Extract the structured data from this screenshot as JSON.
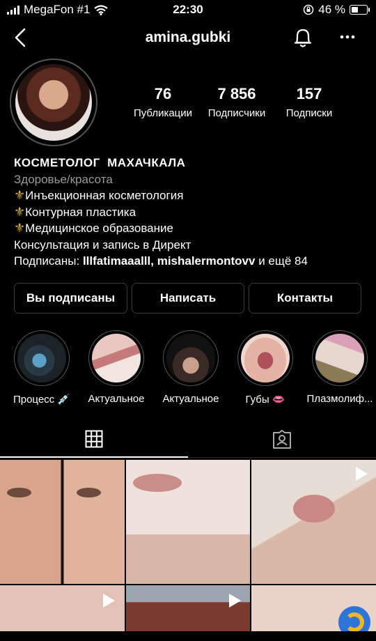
{
  "status_bar": {
    "carrier": "MegaFon #1",
    "time": "22:30",
    "battery": "46 %"
  },
  "nav": {
    "username": "amina.gubki",
    "icons": [
      "back-arrow-icon",
      "bell-icon",
      "more-icon"
    ]
  },
  "stats": [
    {
      "count": "76",
      "label": "Публикации"
    },
    {
      "count": "7 856",
      "label": "Подписчики"
    },
    {
      "count": "157",
      "label": "Подписки"
    }
  ],
  "bio": {
    "name": "КОСМЕТОЛОГ  МАХАЧКАЛА",
    "category": "Здоровье/красота",
    "lines": [
      "Инъекционная косметология",
      "Контурная пластика",
      "Медицинское образование"
    ],
    "cta": "Консультация и запись в Директ",
    "followed_prefix": "Подписаны: ",
    "followed_names": "lllfatimaaalll, mishalermontovv",
    "followed_suffix": " и ещё 84"
  },
  "buttons": {
    "following": "Вы подписаны",
    "message": "Написать",
    "contacts": "Контакты"
  },
  "highlights": [
    {
      "label": "Процесс 💉"
    },
    {
      "label": "Актуальное"
    },
    {
      "label": "Актуальное"
    },
    {
      "label": "Губы 👄"
    },
    {
      "label": "Плазмолиф..."
    }
  ],
  "tabs": [
    "grid-icon",
    "tagged-icon"
  ],
  "colors": {
    "background": "#000000",
    "text": "#ffffff",
    "secondary": "#9a9a9a",
    "button_border": "#3a3a3a",
    "fleur": "#e2b43c"
  }
}
